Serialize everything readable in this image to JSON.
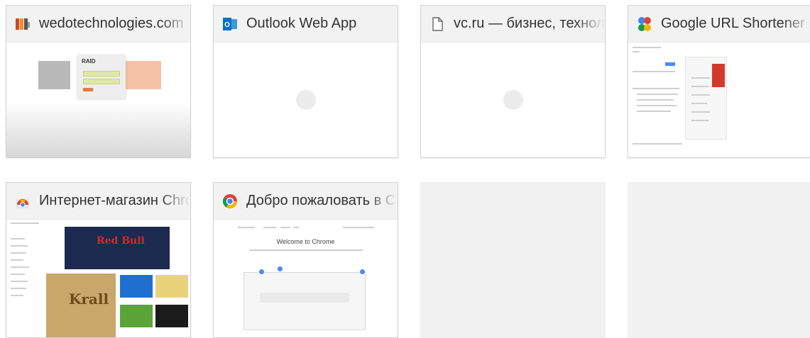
{
  "tiles": [
    {
      "title": "wedotechnologies.com",
      "favicon": "wedo-logo-icon",
      "thumbnail": "login-page-preview",
      "wedo_logo_text": "RAID"
    },
    {
      "title": "Outlook Web App",
      "favicon": "outlook-icon",
      "thumbnail": "loading-placeholder"
    },
    {
      "title": "vc.ru — бизнес, технологии",
      "favicon": "page-icon",
      "thumbnail": "loading-placeholder"
    },
    {
      "title": "Google URL Shortener",
      "favicon": "google-shortener-icon",
      "thumbnail": "page-preview"
    },
    {
      "title": "Интернет-магазин Chrome",
      "favicon": "chrome-web-store-icon",
      "thumbnail": "page-preview",
      "banner_text": "Red Bull",
      "poster_text": "Krall"
    },
    {
      "title": "Добро пожаловать в Chrome",
      "favicon": "chrome-icon",
      "thumbnail": "page-preview",
      "headline": "Welcome to Chrome"
    },
    {
      "title": "",
      "empty": true
    },
    {
      "title": "",
      "empty": true
    }
  ],
  "colors": {
    "tile_header": "#f2f2f2",
    "tile_border": "#d3d3d3",
    "empty_tile": "#f1f1f1",
    "title_text": "#333333",
    "outlook_blue": "#0072c6",
    "chrome_red": "#db4437",
    "chrome_yellow": "#f4b400",
    "chrome_green": "#0f9d58",
    "chrome_blue": "#4285f4"
  }
}
